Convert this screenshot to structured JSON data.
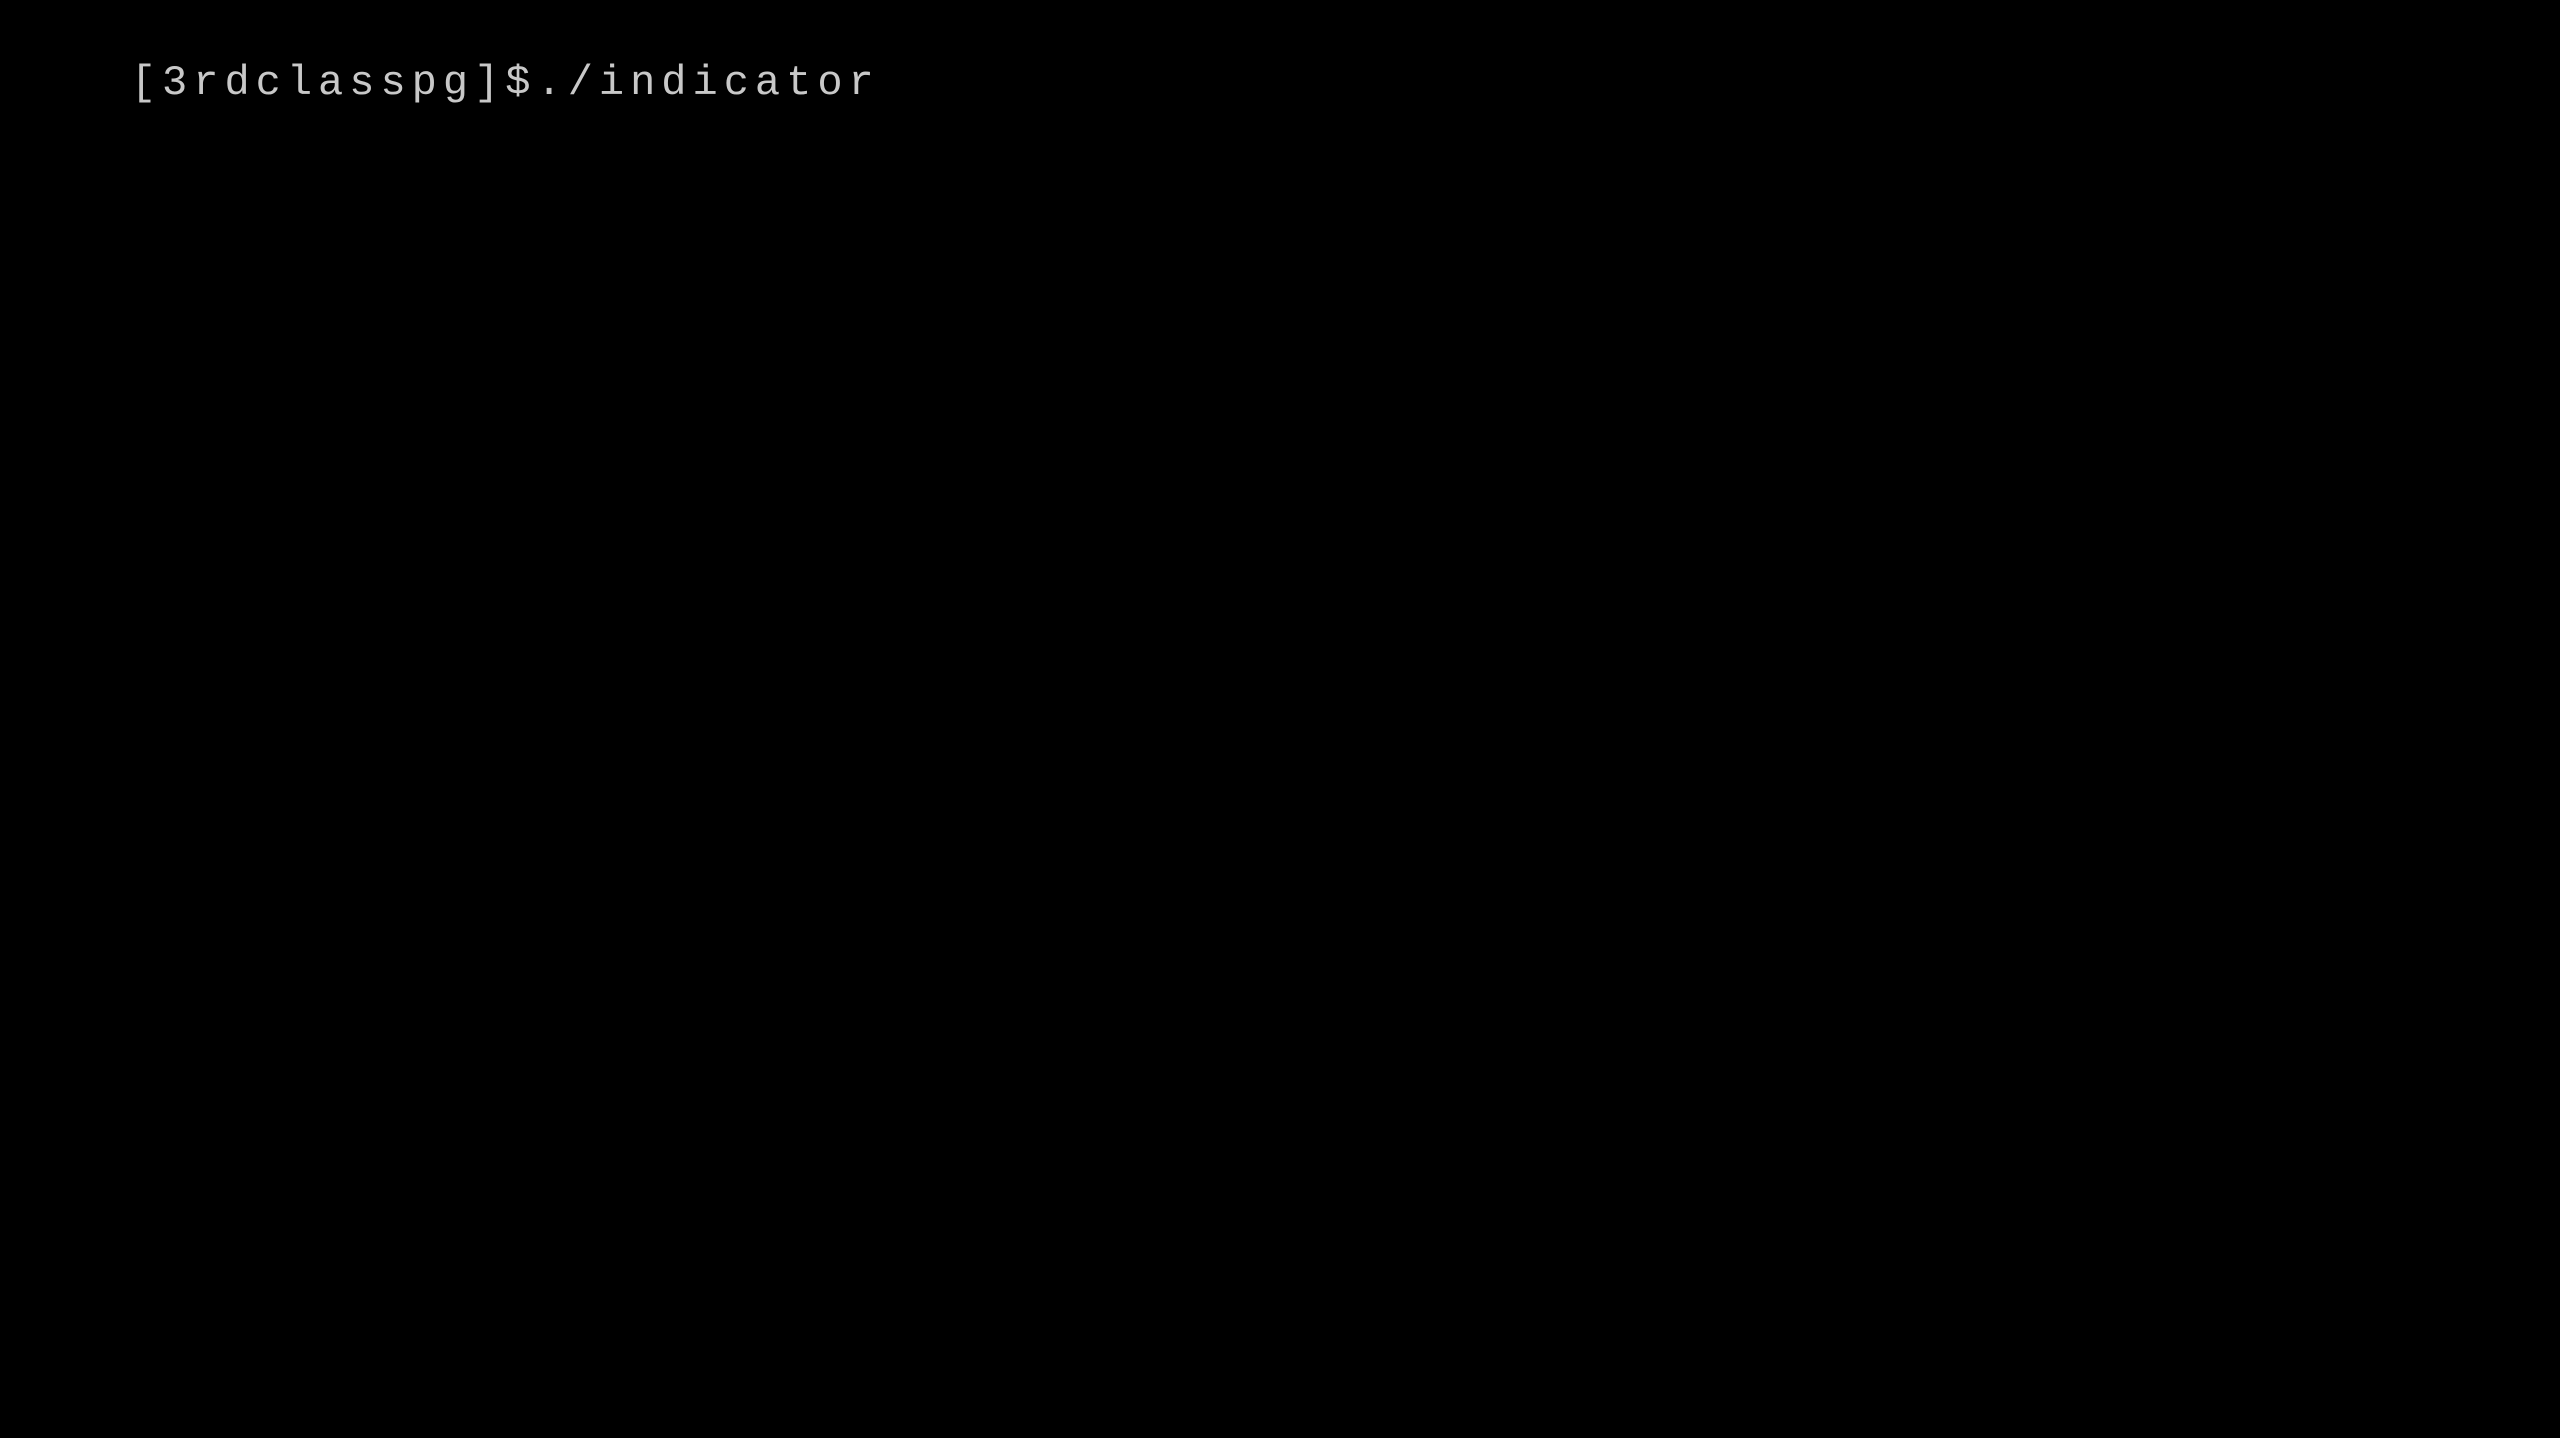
{
  "terminal": {
    "prompt": "[3rdclasspg]$",
    "command": "./indicator"
  }
}
